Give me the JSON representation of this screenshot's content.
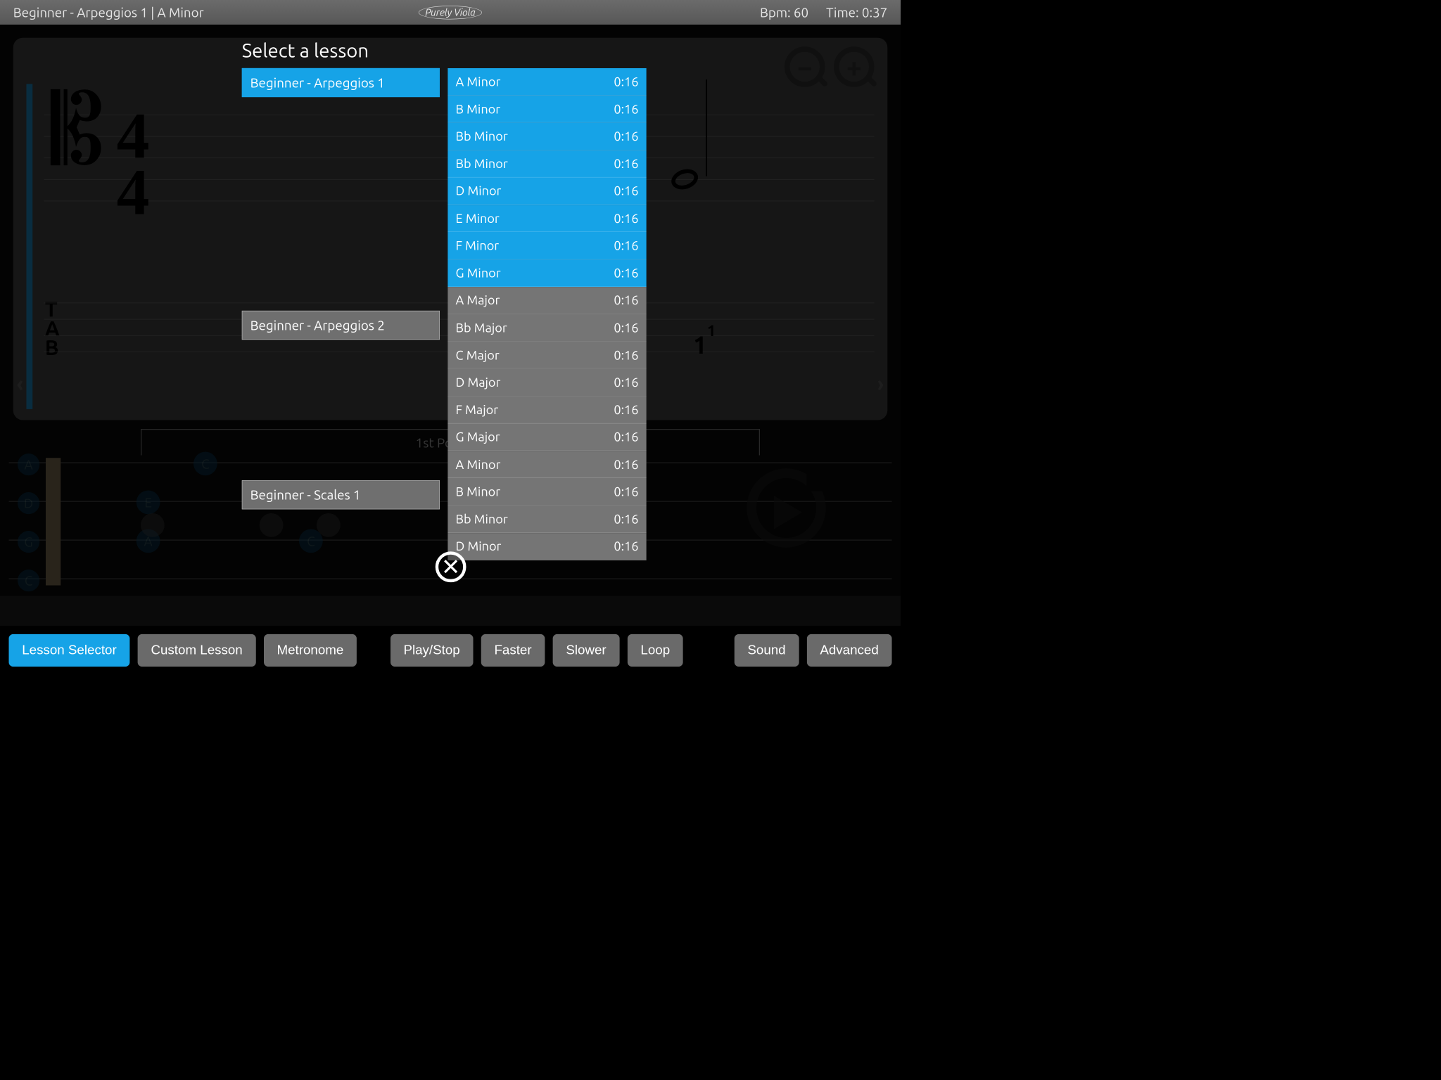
{
  "header": {
    "title": "Beginner - Arpeggios 1  |  A Minor",
    "logo": "Purely Viola",
    "bpm_label": "Bpm: 60",
    "time_label": "Time: 0:37"
  },
  "modal": {
    "title": "Select a lesson",
    "categories": [
      {
        "label": "Beginner - Arpeggios 1",
        "active": true,
        "spacer_after": 486
      },
      {
        "label": "Beginner - Arpeggios 2",
        "active": false,
        "spacer_after": 320
      },
      {
        "label": "Beginner - Scales 1",
        "active": false,
        "spacer_after": 0
      }
    ],
    "lessons": [
      {
        "name": "A Minor",
        "time": "0:16",
        "group": "blue"
      },
      {
        "name": "B Minor",
        "time": "0:16",
        "group": "blue"
      },
      {
        "name": "Bb Minor",
        "time": "0:16",
        "group": "blue"
      },
      {
        "name": "Bb Minor",
        "time": "0:16",
        "group": "blue"
      },
      {
        "name": "D Minor",
        "time": "0:16",
        "group": "blue"
      },
      {
        "name": "E Minor",
        "time": "0:16",
        "group": "blue"
      },
      {
        "name": "F Minor",
        "time": "0:16",
        "group": "blue"
      },
      {
        "name": "G Minor",
        "time": "0:16",
        "group": "blue"
      },
      {
        "name": "A Major",
        "time": "0:16",
        "group": "gray"
      },
      {
        "name": "Bb Major",
        "time": "0:16",
        "group": "gray"
      },
      {
        "name": "C Major",
        "time": "0:16",
        "group": "gray"
      },
      {
        "name": "D Major",
        "time": "0:16",
        "group": "gray"
      },
      {
        "name": "F Major",
        "time": "0:16",
        "group": "gray"
      },
      {
        "name": "G Major",
        "time": "0:16",
        "group": "gray"
      },
      {
        "name": "A Minor",
        "time": "0:16",
        "group": "gray"
      },
      {
        "name": "B Minor",
        "time": "0:16",
        "group": "gray"
      },
      {
        "name": "Bb Minor",
        "time": "0:16",
        "group": "gray"
      },
      {
        "name": "D Minor",
        "time": "0:16",
        "group": "gray"
      }
    ]
  },
  "notation": {
    "timesig_top": "4",
    "timesig_bot": "4",
    "tab_letters": "T\nA\nB",
    "finger_main": "1",
    "finger_super": "1",
    "position_label": "1st Position",
    "string_labels": [
      "A",
      "D",
      "G",
      "C"
    ],
    "fret_notes": [
      "C",
      "E",
      "A",
      "C"
    ]
  },
  "toolbar": {
    "buttons_left": [
      {
        "label": "Lesson Selector",
        "active": true
      },
      {
        "label": "Custom Lesson",
        "active": false
      },
      {
        "label": "Metronome",
        "active": false
      }
    ],
    "buttons_mid": [
      {
        "label": "Play/Stop"
      },
      {
        "label": "Faster"
      },
      {
        "label": "Slower"
      },
      {
        "label": "Loop"
      }
    ],
    "buttons_right": [
      {
        "label": "Sound"
      },
      {
        "label": "Advanced"
      }
    ]
  },
  "icons": {
    "zoom_out": "−",
    "zoom_in": "+",
    "close": "✕"
  }
}
